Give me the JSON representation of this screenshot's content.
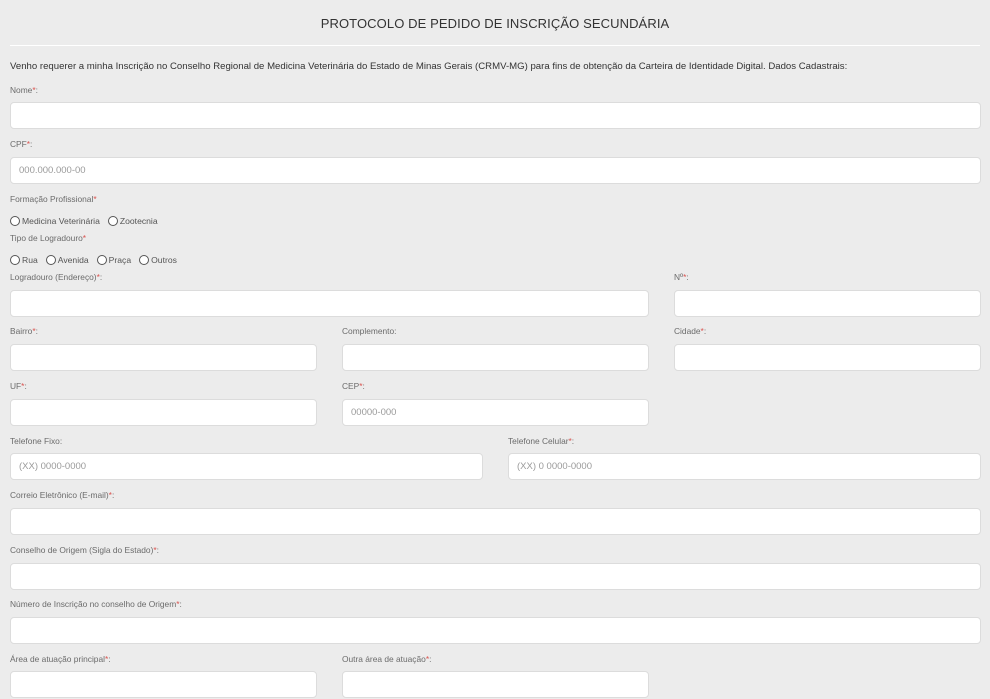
{
  "title": "PROTOCOLO DE PEDIDO DE INSCRIÇÃO SECUNDÁRIA",
  "intro": "Venho requerer a minha Inscrição no Conselho Regional de Medicina Veterinária do Estado de Minas Gerais (CRMV-MG) para fins de obtenção da Carteira de Identidade Digital. Dados Cadastrais:",
  "fields": {
    "nome": {
      "label": "Nome",
      "placeholder": ""
    },
    "cpf": {
      "label": "CPF",
      "placeholder": "000.000.000-00"
    },
    "logradouro": {
      "label": "Logradouro (Endereço)",
      "placeholder": ""
    },
    "numero": {
      "label": "Nº",
      "placeholder": ""
    },
    "bairro": {
      "label": "Bairro",
      "placeholder": ""
    },
    "complemento": {
      "label": "Complemento",
      "placeholder": ""
    },
    "cidade": {
      "label": "Cidade",
      "placeholder": ""
    },
    "uf": {
      "label": "UF",
      "placeholder": ""
    },
    "cep": {
      "label": "CEP",
      "placeholder": "00000-000"
    },
    "telefone_fixo": {
      "label": "Telefone Fixo",
      "placeholder": "(XX) 0000-0000"
    },
    "telefone_celular": {
      "label": "Telefone Celular",
      "placeholder": "(XX) 0 0000-0000"
    },
    "email": {
      "label": "Correio Eletrônico (E-mail)",
      "placeholder": ""
    },
    "conselho_origem": {
      "label": "Conselho de Origem (Sigla do Estado)",
      "placeholder": ""
    },
    "numero_inscricao": {
      "label": "Número de Inscrição no conselho de Origem",
      "placeholder": ""
    },
    "area_principal": {
      "label": "Área de atuação principal",
      "placeholder": ""
    },
    "outra_area": {
      "label": "Outra área de atuação",
      "placeholder": ""
    }
  },
  "formacao": {
    "label": "Formação Profissional",
    "options": [
      "Medicina Veterinária",
      "Zootecnia"
    ]
  },
  "tipo_logradouro": {
    "label": "Tipo de Logradouro",
    "options": [
      "Rua",
      "Avenida",
      "Praça",
      "Outros"
    ]
  },
  "required_mark": "*",
  "colon": ":",
  "colors": {
    "background": "#ececec",
    "field_bg": "#ffffff",
    "required": "#d9534f"
  }
}
